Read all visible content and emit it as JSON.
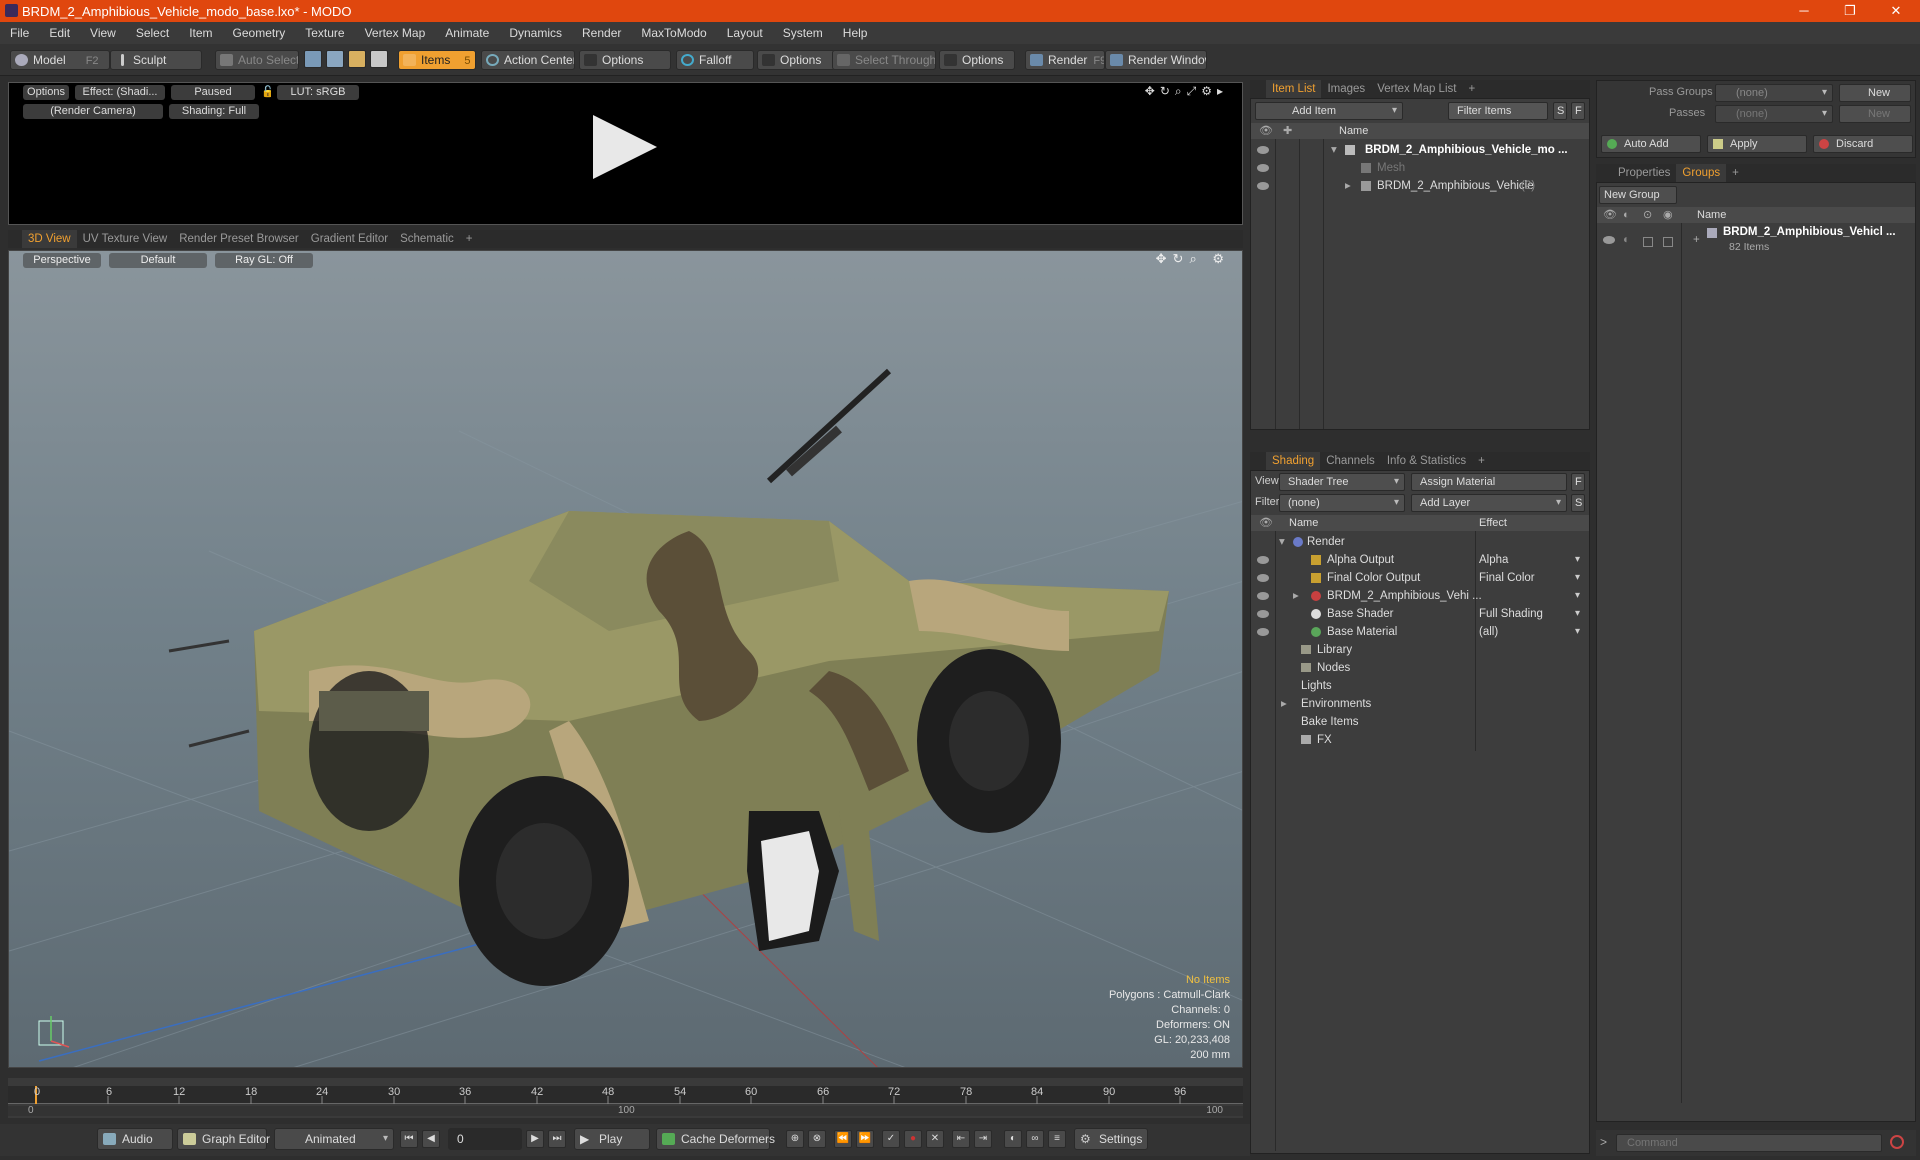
{
  "window": {
    "title": "BRDM_2_Amphibious_Vehicle_modo_base.lxo* - MODO",
    "min": "─",
    "max": "❐",
    "close": "✕"
  },
  "menu": [
    "File",
    "Edit",
    "View",
    "Select",
    "Item",
    "Geometry",
    "Texture",
    "Vertex Map",
    "Animate",
    "Dynamics",
    "Render",
    "MaxToModo",
    "Layout",
    "System",
    "Help"
  ],
  "toolbar": {
    "model": "Model",
    "model_key": "F2",
    "sculpt": "Sculpt",
    "auto_select": "Auto Select",
    "items": "Items",
    "items_key": "5",
    "action_center": "Action Center",
    "options1": "Options",
    "falloff": "Falloff",
    "options2": "Options",
    "select_through": "Select Through",
    "options3": "Options",
    "render": "Render",
    "render_key": "F9",
    "render_window": "Render Window"
  },
  "preview": {
    "options": "Options",
    "effect": "Effect: (Shadi...",
    "paused": "Paused",
    "lut": "LUT: sRGB",
    "camera": "(Render Camera)",
    "shading": "Shading: Full"
  },
  "viewport_tabs": [
    "3D View",
    "UV Texture View",
    "Render Preset Browser",
    "Gradient Editor",
    "Schematic",
    "+"
  ],
  "viewport": {
    "perspective": "Perspective",
    "default": "Default",
    "raygl": "Ray GL: Off",
    "stats": [
      "No Items",
      "Polygons : Catmull-Clark",
      "Channels: 0",
      "Deformers: ON",
      "GL: 20,233,408",
      "200 mm"
    ]
  },
  "timeline": {
    "ticks": [
      "0",
      "6",
      "12",
      "18",
      "24",
      "30",
      "36",
      "42",
      "48",
      "54",
      "60",
      "66",
      "72",
      "78",
      "84",
      "90",
      "96"
    ],
    "range": [
      "0",
      "100",
      "100"
    ]
  },
  "bottombar": {
    "audio": "Audio",
    "graph_editor": "Graph Editor",
    "animated": "Animated",
    "frame": "0",
    "play": "Play",
    "cache": "Cache Deformers",
    "settings": "Settings"
  },
  "itemlist": {
    "tabs": [
      "Item List",
      "Images",
      "Vertex Map List",
      "+"
    ],
    "add_item": "Add Item",
    "filter_items": "Filter Items",
    "s": "S",
    "f": "F",
    "name_header": "Name",
    "rows": [
      {
        "label": "BRDM_2_Amphibious_Vehicle_mo ..."
      },
      {
        "label": "Mesh"
      },
      {
        "label": "BRDM_2_Amphibious_Vehicle",
        "count": "(2)"
      }
    ]
  },
  "shading": {
    "tabs": [
      "Shading",
      "Channels",
      "Info & Statistics",
      "+"
    ],
    "view_label": "View",
    "view_value": "Shader Tree",
    "assign_material": "Assign Material",
    "f": "F",
    "filter_label": "Filter",
    "filter_value": "(none)",
    "add_layer": "Add Layer",
    "s": "S",
    "name_header": "Name",
    "effect_header": "Effect",
    "rows": [
      {
        "label": "Render",
        "effect": ""
      },
      {
        "label": "Alpha Output",
        "effect": "Alpha"
      },
      {
        "label": "Final Color Output",
        "effect": "Final Color"
      },
      {
        "label": "BRDM_2_Amphibious_Vehi ...",
        "effect": ""
      },
      {
        "label": "Base Shader",
        "effect": "Full Shading"
      },
      {
        "label": "Base Material",
        "effect": "(all)"
      },
      {
        "label": "Library",
        "effect": ""
      },
      {
        "label": "Nodes",
        "effect": ""
      },
      {
        "label": "Lights",
        "effect": ""
      },
      {
        "label": "Environments",
        "effect": ""
      },
      {
        "label": "Bake Items",
        "effect": ""
      },
      {
        "label": "FX",
        "effect": ""
      }
    ]
  },
  "passes": {
    "pass_groups": "Pass Groups",
    "pass_groups_value": "(none)",
    "new1": "New",
    "passes": "Passes",
    "passes_value": "(none)",
    "new2": "New",
    "auto_add": "Auto Add",
    "apply": "Apply",
    "discard": "Discard"
  },
  "groups": {
    "tabs": [
      "Properties",
      "Groups",
      "+"
    ],
    "new_group": "New Group",
    "name_header": "Name",
    "group_name": "BRDM_2_Amphibious_Vehicl ...",
    "group_count": "82 Items"
  },
  "command": {
    "placeholder": "Command"
  },
  "colors": {
    "accent": "#f0a030",
    "titlebar": "#e0470e"
  }
}
